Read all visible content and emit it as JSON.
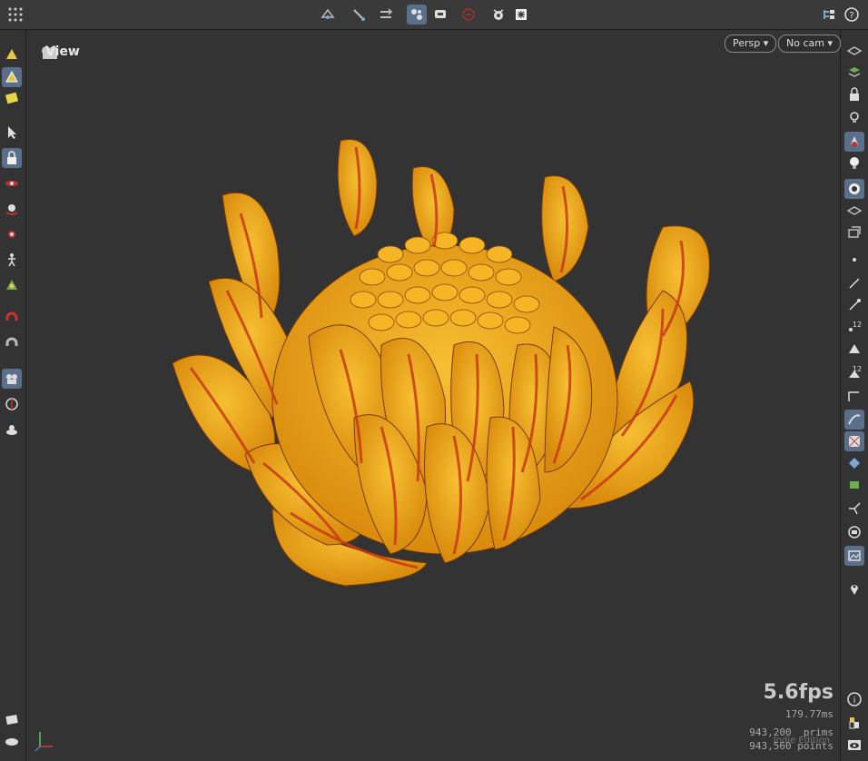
{
  "viewport": {
    "title": "View",
    "projection": "Persp",
    "camera": "No cam"
  },
  "stats": {
    "fps": "5.6fps",
    "frame_time": "179.77ms",
    "prims_value": "943,200",
    "prims_label": "prims",
    "points_value": "943,560",
    "points_label": "points",
    "edition": "Indie Edition"
  },
  "icons": {
    "menu": "grid-menu-icon",
    "help": "help-icon",
    "info": "info-icon"
  },
  "colors": {
    "petal": "#f2ae1c",
    "stripe": "#d0401a",
    "active": "#5a6f8a"
  }
}
